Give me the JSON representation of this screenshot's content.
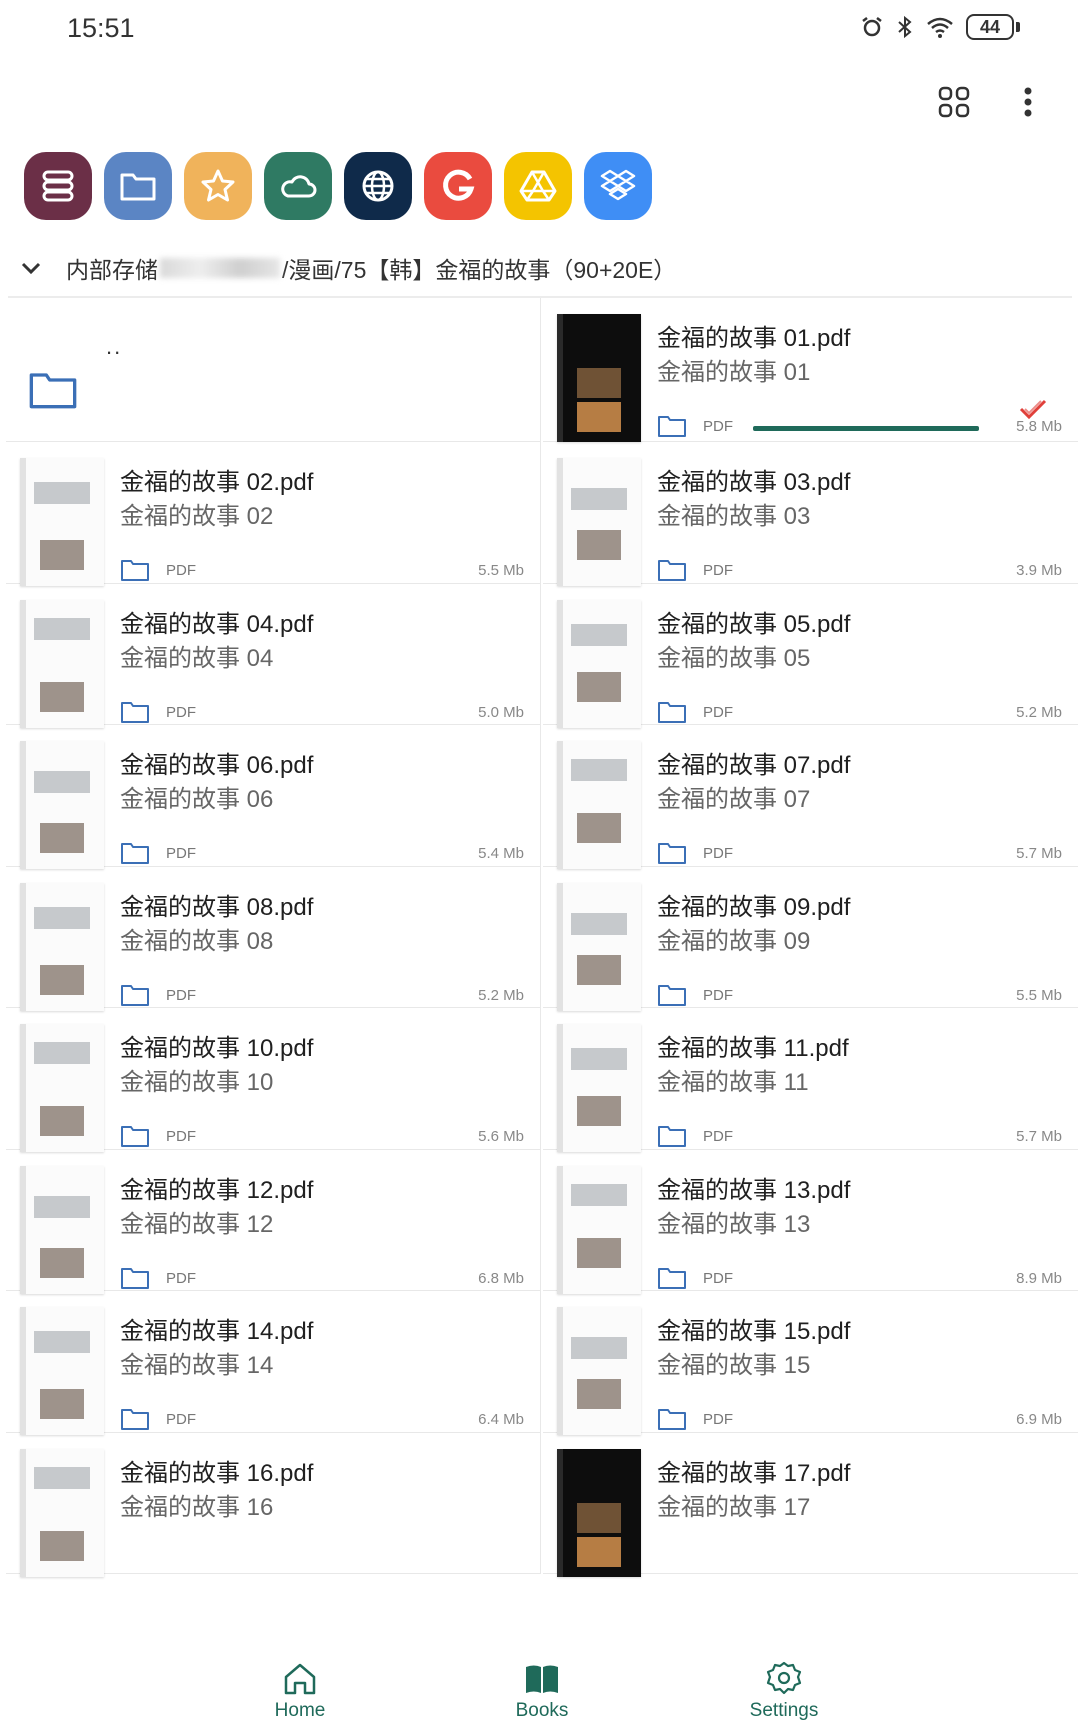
{
  "status": {
    "time": "15:51",
    "battery": "44"
  },
  "sources": [
    {
      "name": "storage-shelf-icon",
      "color": "#6b2f47"
    },
    {
      "name": "folder-icon",
      "color": "#5b85c4"
    },
    {
      "name": "star-icon",
      "color": "#f0b35b"
    },
    {
      "name": "cloud-icon",
      "color": "#2f7a63"
    },
    {
      "name": "globe-icon",
      "color": "#0f2a4a"
    },
    {
      "name": "google-icon",
      "color": "#ea4b3f"
    },
    {
      "name": "drive-icon",
      "color": "#f4c400"
    },
    {
      "name": "dropbox-icon",
      "color": "#3f8ef5"
    }
  ],
  "path": {
    "prefix": "内部存储",
    "suffix": "/漫画/75【韩】金福的故事（90+20E）"
  },
  "updir_label": "..",
  "files": [
    {
      "title": "金福的故事 01.pdf",
      "subtitle": "金福的故事 01",
      "format": "PDF",
      "size": "5.8 Mb",
      "progress": 1.0,
      "read": true,
      "dark": true
    },
    {
      "title": "金福的故事 02.pdf",
      "subtitle": "金福的故事 02",
      "format": "PDF",
      "size": "5.5 Mb"
    },
    {
      "title": "金福的故事 03.pdf",
      "subtitle": "金福的故事 03",
      "format": "PDF",
      "size": "3.9 Mb"
    },
    {
      "title": "金福的故事 04.pdf",
      "subtitle": "金福的故事 04",
      "format": "PDF",
      "size": "5.0 Mb"
    },
    {
      "title": "金福的故事 05.pdf",
      "subtitle": "金福的故事 05",
      "format": "PDF",
      "size": "5.2 Mb"
    },
    {
      "title": "金福的故事 06.pdf",
      "subtitle": "金福的故事 06",
      "format": "PDF",
      "size": "5.4 Mb"
    },
    {
      "title": "金福的故事 07.pdf",
      "subtitle": "金福的故事 07",
      "format": "PDF",
      "size": "5.7 Mb"
    },
    {
      "title": "金福的故事 08.pdf",
      "subtitle": "金福的故事 08",
      "format": "PDF",
      "size": "5.2 Mb"
    },
    {
      "title": "金福的故事 09.pdf",
      "subtitle": "金福的故事 09",
      "format": "PDF",
      "size": "5.5 Mb"
    },
    {
      "title": "金福的故事 10.pdf",
      "subtitle": "金福的故事 10",
      "format": "PDF",
      "size": "5.6 Mb"
    },
    {
      "title": "金福的故事 11.pdf",
      "subtitle": "金福的故事 11",
      "format": "PDF",
      "size": "5.7 Mb"
    },
    {
      "title": "金福的故事 12.pdf",
      "subtitle": "金福的故事 12",
      "format": "PDF",
      "size": "6.8 Mb"
    },
    {
      "title": "金福的故事 13.pdf",
      "subtitle": "金福的故事 13",
      "format": "PDF",
      "size": "8.9 Mb"
    },
    {
      "title": "金福的故事 14.pdf",
      "subtitle": "金福的故事 14",
      "format": "PDF",
      "size": "6.4 Mb"
    },
    {
      "title": "金福的故事 15.pdf",
      "subtitle": "金福的故事 15",
      "format": "PDF",
      "size": "6.9 Mb"
    },
    {
      "title": "金福的故事 16.pdf",
      "subtitle": "金福的故事 16",
      "format": "",
      "size": ""
    },
    {
      "title": "金福的故事 17.pdf",
      "subtitle": "金福的故事 17",
      "format": "",
      "size": "",
      "dark": true
    }
  ],
  "nav": {
    "home": "Home",
    "books": "Books",
    "settings": "Settings"
  },
  "colors": {
    "accent": "#1f6a5a",
    "folder": "#3b6fb6",
    "check": "#e0403a"
  }
}
